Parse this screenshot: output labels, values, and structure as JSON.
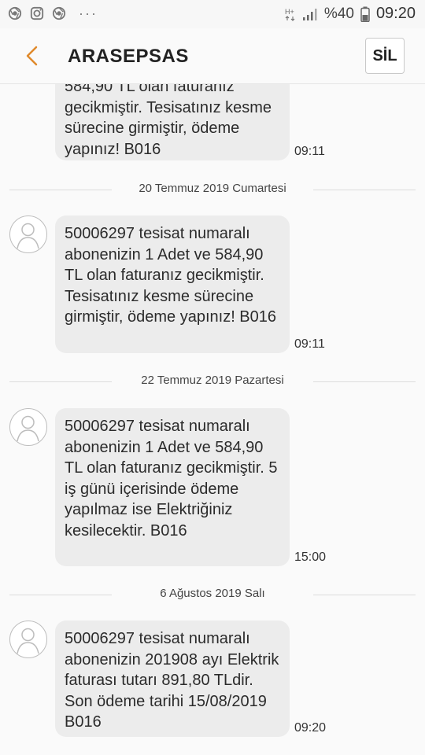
{
  "status_bar": {
    "left_icons": [
      "chrome-icon",
      "instagram-icon",
      "chrome-icon"
    ],
    "more": "···",
    "battery": "%40",
    "time": "09:20"
  },
  "header": {
    "title": "ARASEPSAS",
    "delete_label": "SİL"
  },
  "messages": [
    {
      "text": "584,90 TL olan faturanız gecikmiştir. Tesisatınız kesme sürecine girmiştir, ödeme yapınız! B016",
      "time": "09:11"
    },
    {
      "date": "20 Temmuz 2019 Cumartesi",
      "text": "50006297 tesisat numaralı abonenizin 1 Adet ve 584,90 TL olan faturanız gecikmiştir. Tesisatınız kesme sürecine girmiştir, ödeme yapınız! B016",
      "time": "09:11"
    },
    {
      "date": "22 Temmuz 2019 Pazartesi",
      "text": "50006297 tesisat numaralı abonenizin 1 Adet ve 584,90 TL olan faturanız gecikmiştir. 5 iş günü içerisinde ödeme yapılmaz ise Elektriğiniz kesilecektir. B016",
      "time": "15:00"
    },
    {
      "date": "6 Ağustos 2019 Salı",
      "text": "50006297 tesisat numaralı abonenizin 201908 ayı Elektrik faturası tutarı 891,80 TLdir. Son ödeme tarihi 15/08/2019 B016",
      "time": "09:20"
    }
  ]
}
